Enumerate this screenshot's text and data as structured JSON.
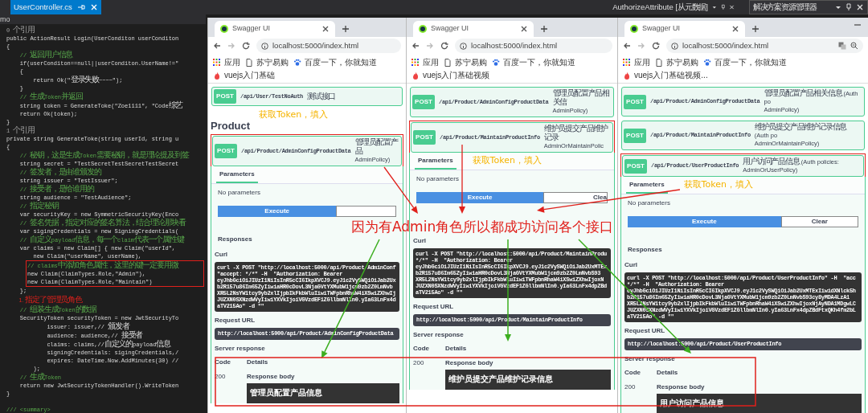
{
  "ide": {
    "tab": "UserController.cs",
    "breadcrumb": "mo",
    "panels": [
      {
        "title": "AuthorizeAttribute [从元数据]"
      },
      {
        "title": "解决方案资源管理器"
      }
    ]
  },
  "code": [
    {
      "kind": "ref",
      "text": "0 个引用"
    },
    {
      "kind": "code",
      "text": "public ActionResult Login(UserConditon userConditon"
    },
    {
      "kind": "code",
      "text": "{"
    },
    {
      "kind": "comment",
      "text": "    // 返回用户信息"
    },
    {
      "kind": "code",
      "text": "    if(userConditon==null||userConditon.UserName!=\""
    },
    {
      "kind": "code",
      "text": "    {"
    },
    {
      "kind": "code",
      "text": "        return Ok(\"登录失败~~~~\");"
    },
    {
      "kind": "code",
      "text": "    }"
    },
    {
      "kind": "comment",
      "text": "    // 生成Token并返回"
    },
    {
      "kind": "code",
      "text": "    string token = GenerateToke(\"Zoe1111\", \"Code综艺"
    },
    {
      "kind": "code",
      "text": "    return Ok(token);"
    },
    {
      "kind": "code",
      "text": "}"
    },
    {
      "kind": "ref",
      "text": "1 个引用"
    },
    {
      "kind": "code",
      "text": "private string GenerateToke(string userId, string u"
    },
    {
      "kind": "code",
      "text": "{"
    },
    {
      "kind": "comment",
      "text": "    // 秘钥，这是生成Token需要秘钥，就是理论提及到签"
    },
    {
      "kind": "code",
      "text": "    string secret = \"TestSecretTestSecretTestSecret"
    },
    {
      "kind": "comment",
      "text": "    // 签发者，是由谁颁发的"
    },
    {
      "kind": "code",
      "text": "    string issuer = \"TestIssuer\";"
    },
    {
      "kind": "comment",
      "text": "    // 接受者，是给谁用的"
    },
    {
      "kind": "code",
      "text": "    string audience = \"TestAudience\";"
    },
    {
      "kind": "comment",
      "text": "    // 指定秘钥"
    },
    {
      "kind": "code",
      "text": "    var securityKey = new SymmetricSecurityKey(Enco"
    },
    {
      "kind": "comment",
      "text": "    // 签名凭据，指定对应的签名算法，结合理论那块看"
    },
    {
      "kind": "code",
      "text": "    var sigingCredentials = new SigningCredentials("
    },
    {
      "kind": "comment",
      "text": "    // 自定义payload信息，每一个claim代表一个属性键"
    },
    {
      "kind": "code",
      "text": "    var claims = new Claim[] { new Claim(\"userId\","
    },
    {
      "kind": "code",
      "text": "        new Claim(\"userName\", userName),"
    },
    {
      "kind": "box",
      "lines": [
        {
          "kind": "comment",
          "text": "// claims中添加角色属性，这里的键一定要用微"
        },
        {
          "kind": "code",
          "text": "new Claim(ClaimTypes.Role,\"Admin\"),"
        },
        {
          "kind": "code",
          "text": "new Claim(ClaimTypes.Role,\"Maintain\")"
        }
      ]
    },
    {
      "kind": "code",
      "text": "    };"
    },
    {
      "kind": "annotation",
      "text": "        1. 指定了管理员角色"
    },
    {
      "kind": "comment",
      "text": "    // 组装生成Token的数据"
    },
    {
      "kind": "code",
      "text": "    SecurityToken securityToken = new JwtSecurityTo"
    },
    {
      "kind": "code",
      "text": "            issuer: issuer,// 颁发者"
    },
    {
      "kind": "code",
      "text": "            audience: audience,// 接受者"
    },
    {
      "kind": "code",
      "text": "            claims: claims,//自定义的payload信息"
    },
    {
      "kind": "code",
      "text": "            signingCredentials: sigingCredentials,/"
    },
    {
      "kind": "code",
      "text": "            expires: DateTime.Now.AddMinutes(30) //"
    },
    {
      "kind": "code",
      "text": "        );"
    },
    {
      "kind": "comment",
      "text": "    // 生成Token"
    },
    {
      "kind": "code",
      "text": "    return new JwtSecurityTokenHandler().WriteToken"
    },
    {
      "kind": "code",
      "text": "}"
    },
    {
      "kind": "blank"
    },
    {
      "kind": "comment",
      "text": "/// <summary>"
    }
  ],
  "windows": [
    {
      "tab": "Swagger UI",
      "url": "localhost:5000/index.html",
      "bookmarks": [
        "应用",
        "苏宁易购",
        "百度一下，你就知道",
        "vuejs入门基础"
      ],
      "blocks": [
        {
          "kind": "endpoint",
          "method": "POST",
          "path": "/api/User/TestNoAuth",
          "summary": "测试接口",
          "highlighted": false
        },
        {
          "kind": "note",
          "text": "获取Token，填入"
        },
        {
          "kind": "heading",
          "text": "Product"
        },
        {
          "kind": "endpoint",
          "method": "POST",
          "path": "/api/Product/AdminConfigProductData",
          "summary": "管理员配置产品",
          "policy": "AdminPolicy)",
          "highlighted": true
        },
        {
          "kind": "operation",
          "tab": "Parameters",
          "params": "No parameters",
          "execute": "Execute",
          "responses": "Responses",
          "curl_label": "Curl",
          "curl": [
            "curl -X POST \"http://localhost:5000/api/Product/AdminConf",
            "\"accept: */*\" -H  \"Authorization: Bearer",
            "eyJhbGciOiJIUzI1NiIsInR5cCI6IkpXVCJ9.eyJ1c2VySWQiOiJab2Ux",
            "b2R157u86Im65ZyIiwiaHR0cDovL3NjaGVtYXMubW1jcm9zb2Z0LmNvb",
            "XR5L2NsYW1tcy9yb2xlIjpbIkFkbWluIiwiTWFpbnRhaW4iXSwiZXhwIj",
            "JUZXN0SXNzdWVyIiwiYXVkIjoiVGVzdEF1ZGllbmNlIn0.yIa63LnFx4d",
            "aTV215Ao\" -d \"\""
          ],
          "request_url_label": "Request URL",
          "request_url": "http://localhost:5000/api/Product/AdminConfigProductData",
          "server_response_label": "Server response",
          "code_header": "Code",
          "details_header": "Details",
          "code": "200",
          "body_label": "Response body",
          "body": "管理员配置产品信息"
        }
      ]
    },
    {
      "tab": "Swagger UI",
      "url": "localhost:5000/index.html",
      "bookmarks": [
        "应用",
        "苏宁易购",
        "百度一下，你就知道",
        "vuejs入门基础视频"
      ],
      "blocks": [
        {
          "kind": "endpoint",
          "method": "POST",
          "path": "/api/Product/AdminConfigProductData",
          "summary": "管理员配置产品相关信",
          "policy": "AdminPolicy)",
          "highlighted": false
        },
        {
          "kind": "endpoint",
          "method": "POST",
          "path": "/api/Product/MaintainProductInfo",
          "summary": "维护员提交产品维护记录",
          "policy": "AdminOrMaintainPolic",
          "highlighted": true
        },
        {
          "kind": "operation",
          "tab": "Parameters",
          "note": "获取Token，填入",
          "params": "No parameters",
          "execute": "Execute",
          "clear": "Clea",
          "curl_label": "Curl",
          "curl": [
            "curl -X POST \"http://localhost:5000/api/Product/MaintainProdu",
            "*/*\" -H  \"Authorization: Bearer",
            "eyJhbGciOiJIUzI1NiIsInR5cCI6IkpXVCJ9.eyJ1c2VySWQiOiJab2UxMTEx",
            "b2R157u86Im65ZyIiwiaHR0cDovL3NjaGVtYXMubW1jcm9zb2Z0LmNvbS93",
            "XR5L2NsYW1tcy9yb2xlIjpbIkFkbWluIiwiTWFpbnRhaW4iXSwiZXhwIjoxN",
            "JUZXN0SXNzdWVyIiwiYXVkIjoiVGVzdEF1ZGllbmNlIn0.yIa63LnFx4dpZBd",
            "aTV215Ao\" -d \"\""
          ],
          "request_url_label": "Request URL",
          "request_url": "http://localhost:5000/api/Product/MaintainProductInfo",
          "server_response_label": "Server response",
          "code_header": "Code",
          "details_header": "Details",
          "code": "200",
          "body_label": "Response body",
          "body": "维护员提交产品维护记录信息"
        }
      ]
    },
    {
      "tab": "Swagger UI",
      "url": "localhost:5000/index.html",
      "bookmarks": [
        "应用",
        "苏宁易购",
        "百度一下，你就知道",
        "vuejs入门基础视频..."
      ],
      "blocks": [
        {
          "kind": "endpoint",
          "method": "POST",
          "path": "/api/Product/AdminConfigProductData",
          "summary": "管理员配置产品相关信息 (Auth po",
          "policy": "AdminPolicy)",
          "highlighted": false
        },
        {
          "kind": "endpoint",
          "method": "POST",
          "path": "/api/Product/MaintainProductInfo",
          "summary": "维护员提交产品维护记录信息 (Auth po",
          "policy": "AdminOrMaintainPolicy)",
          "highlighted": false
        },
        {
          "kind": "endpoint",
          "method": "POST",
          "path": "/api/Product/UserProductInfo",
          "summary": "用户访问产品信息 (Auth policies:",
          "policy": "AdminOrUserPolicy)",
          "highlighted": true
        },
        {
          "kind": "operation",
          "tab": "Parameters",
          "note": "获取Token，填入",
          "params": "No parameters",
          "execute": "Execute",
          "clear": "Clear",
          "responses": "Responses",
          "curl_label": "Curl",
          "curl": [
            "curl -X POST \"http://localhost:5000/api/Product/UserProductInfo\" -H  \"acc",
            "*/*\" -H  \"Authorization: Bearer",
            "eyJhbGciOiJIUzI1NiIsInR5cCI6IkpXVCJ9.eyJ1c2VySWQiOiJab2UxMTExIiwidXNlck5h",
            "b2R157u86Im65ZyIiwiaHR0cDovL3NjaGVtYXMubW1jcm9zb2Z0LmNvbS93cy8yMDA4LzA1",
            "XR5L2NsYW1tcy9yb2xlIjpbIkFkbWluIiwiTWFpbnRhaW4iXSwiZXhwIjoxNjAyNDA1MDgwLC",
            "JUZXN0SXNzdWVyIiwiYXVkIjoiVGVzdEF1ZGllbmNlIn0.yIa63LnFx4dpZBdFtxQKh4fm2bL",
            "aTV215Ao\" -d \"\""
          ],
          "request_url_label": "Request URL",
          "request_url": "http://localhost:5000/api/Product/UserProductInfo",
          "server_response_label": "Server response",
          "code_header": "Code",
          "details_header": "Details",
          "code": "200",
          "body_label": "Response body",
          "body": "用户访问产品信息"
        }
      ]
    }
  ],
  "callout": "因为有Admin角色所以都成功访问各个接口"
}
